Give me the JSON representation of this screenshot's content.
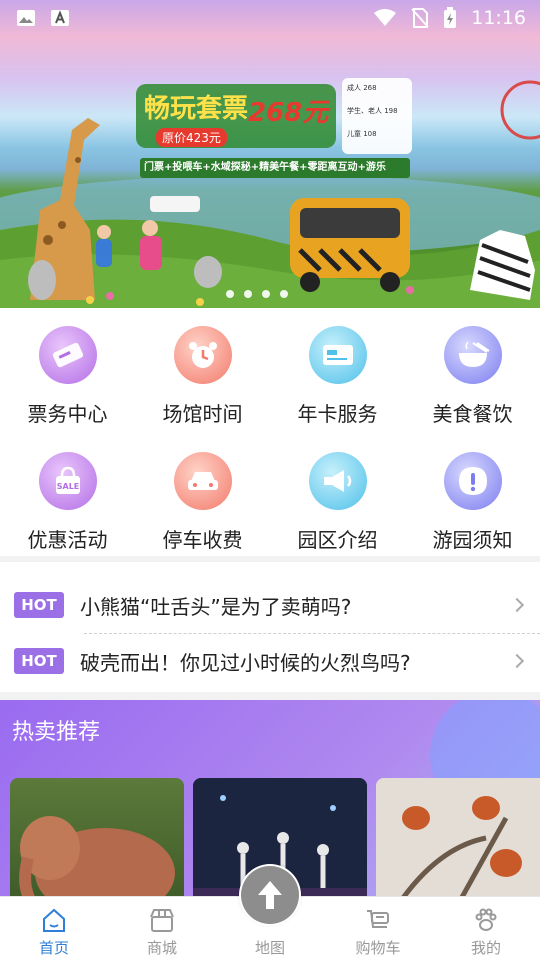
{
  "status_bar": {
    "time": "11:16"
  },
  "banner": {
    "headline": "畅玩套票",
    "price": "268元",
    "original_price": "原价423元",
    "price_list": [
      "成人 268",
      "学生、老人 198",
      "儿童 108"
    ],
    "slogan": "门票+投喂车+水域探秘+精美午餐+零距离互动+游乐",
    "dot_count": 4
  },
  "menu": {
    "items": [
      {
        "label": "票务中心",
        "icon": "ticket-icon",
        "color": "#b36ee6"
      },
      {
        "label": "场馆时间",
        "icon": "alarm-clock-icon",
        "color": "#f27a6b"
      },
      {
        "label": "年卡服务",
        "icon": "card-icon",
        "color": "#4fc0e9"
      },
      {
        "label": "美食餐饮",
        "icon": "food-bowl-icon",
        "color": "#7b7df0"
      },
      {
        "label": "优惠活动",
        "icon": "sale-bag-icon",
        "color": "#b36ee6"
      },
      {
        "label": "停车收费",
        "icon": "car-icon",
        "color": "#f27a6b"
      },
      {
        "label": "园区介绍",
        "icon": "megaphone-icon",
        "color": "#4fc0e9"
      },
      {
        "label": "游园须知",
        "icon": "notice-icon",
        "color": "#7b7df0"
      }
    ]
  },
  "news": {
    "tag": "HOT",
    "items": [
      {
        "title": "小熊猫“吐舌头”是为了卖萌吗?"
      },
      {
        "title": "破壳而出！你见过小时候的火烈鸟吗?"
      }
    ]
  },
  "hot_recommend": {
    "title": "热卖推荐"
  },
  "bottom_nav": {
    "items": [
      {
        "label": "首页",
        "icon": "home-icon",
        "active": true
      },
      {
        "label": "商城",
        "icon": "shop-icon",
        "active": false
      },
      {
        "label": "地图",
        "icon": "map-arrow-icon",
        "active": false
      },
      {
        "label": "购物车",
        "icon": "cart-icon",
        "active": false
      },
      {
        "label": "我的",
        "icon": "paw-icon",
        "active": false
      }
    ]
  }
}
